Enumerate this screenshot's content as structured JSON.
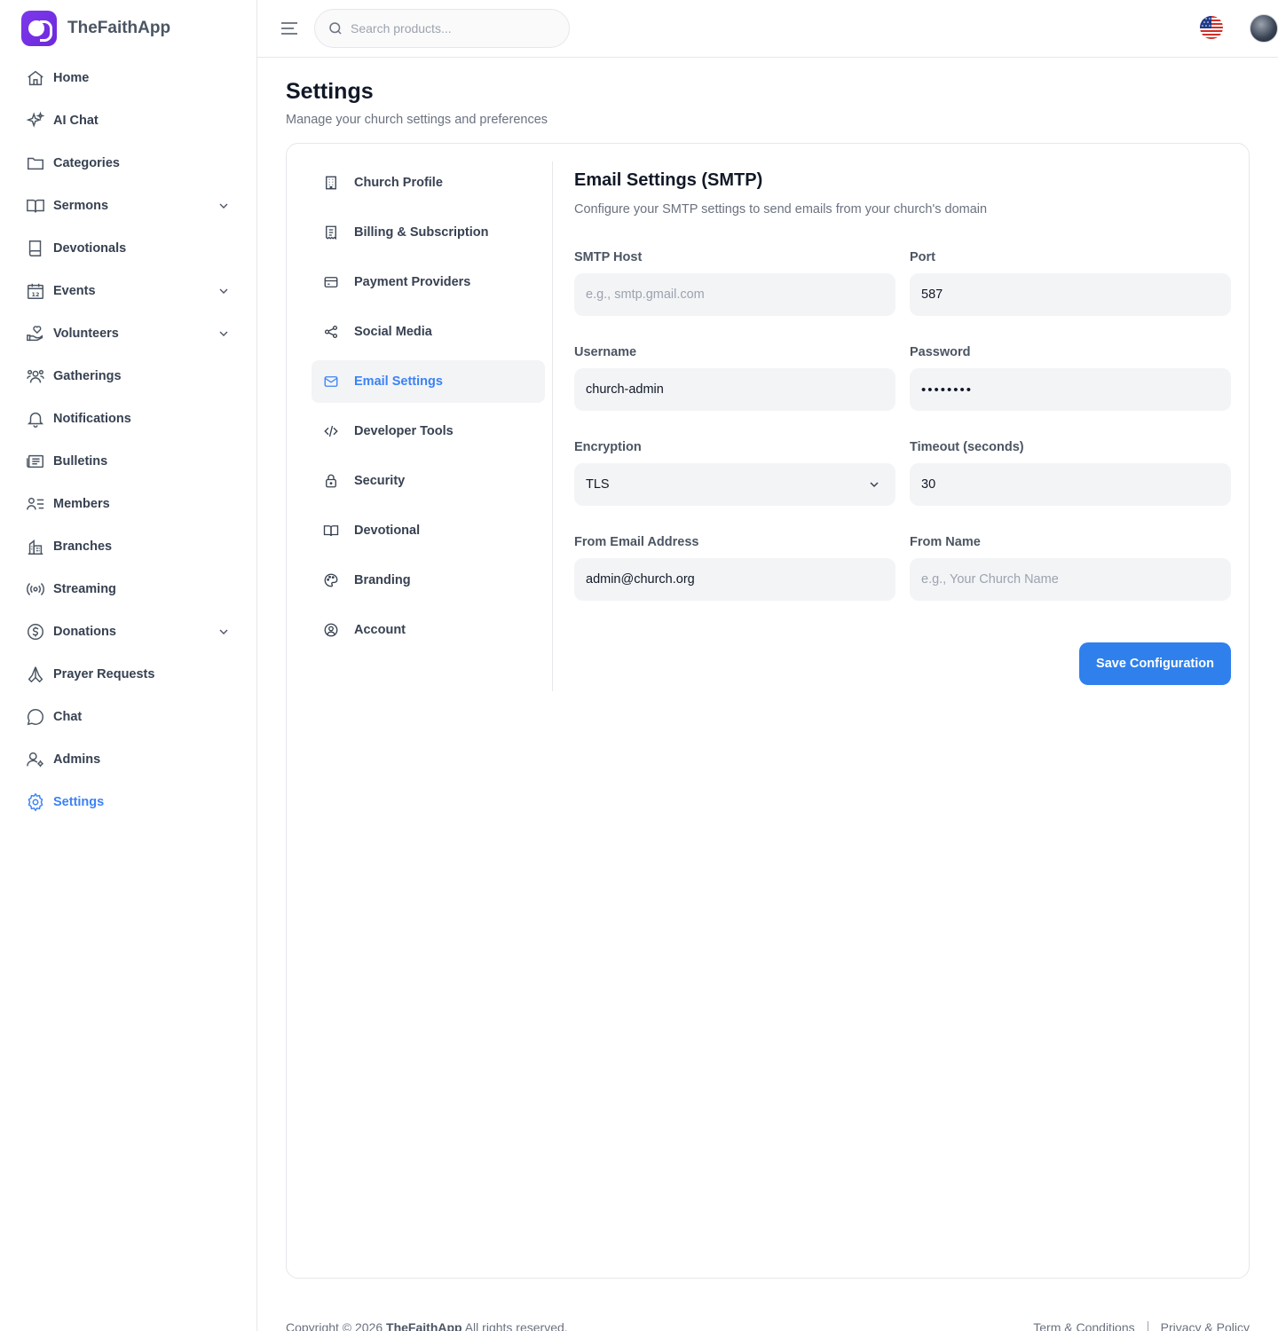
{
  "app": {
    "name": "TheFaithApp"
  },
  "sidebar": {
    "items": [
      {
        "label": "Home",
        "icon": "home-icon"
      },
      {
        "label": "AI Chat",
        "icon": "sparkles-icon"
      },
      {
        "label": "Categories",
        "icon": "folder-icon"
      },
      {
        "label": "Sermons",
        "icon": "book-open-icon",
        "expandable": true
      },
      {
        "label": "Devotionals",
        "icon": "book-icon"
      },
      {
        "label": "Events",
        "icon": "calendar-icon",
        "expandable": true
      },
      {
        "label": "Volunteers",
        "icon": "hand-heart-icon",
        "expandable": true
      },
      {
        "label": "Gatherings",
        "icon": "users-icon"
      },
      {
        "label": "Notifications",
        "icon": "bell-icon"
      },
      {
        "label": "Bulletins",
        "icon": "newspaper-icon"
      },
      {
        "label": "Members",
        "icon": "user-list-icon"
      },
      {
        "label": "Branches",
        "icon": "building-icon"
      },
      {
        "label": "Streaming",
        "icon": "broadcast-icon"
      },
      {
        "label": "Donations",
        "icon": "dollar-icon",
        "expandable": true
      },
      {
        "label": "Prayer Requests",
        "icon": "praying-hands-icon"
      },
      {
        "label": "Chat",
        "icon": "chat-bubble-icon"
      },
      {
        "label": "Admins",
        "icon": "user-gear-icon"
      },
      {
        "label": "Settings",
        "icon": "gear-icon",
        "active": true
      }
    ]
  },
  "header": {
    "search_placeholder": "Search products...",
    "language_flag": "us-flag-icon"
  },
  "page": {
    "title": "Settings",
    "subtitle": "Manage your church settings and preferences"
  },
  "settings_nav": {
    "items": [
      {
        "label": "Church Profile",
        "icon": "building-icon"
      },
      {
        "label": "Billing & Subscription",
        "icon": "receipt-icon"
      },
      {
        "label": "Payment Providers",
        "icon": "credit-card-icon"
      },
      {
        "label": "Social Media",
        "icon": "share-icon"
      },
      {
        "label": "Email Settings",
        "icon": "mail-icon",
        "active": true
      },
      {
        "label": "Developer Tools",
        "icon": "code-icon"
      },
      {
        "label": "Security",
        "icon": "lock-icon"
      },
      {
        "label": "Devotional",
        "icon": "book-open-icon"
      },
      {
        "label": "Branding",
        "icon": "palette-icon"
      },
      {
        "label": "Account",
        "icon": "user-circle-icon"
      }
    ]
  },
  "form": {
    "title": "Email Settings (SMTP)",
    "description": "Configure your SMTP settings to send emails from your church's domain",
    "fields": {
      "smtp_host": {
        "label": "SMTP Host",
        "value": "",
        "placeholder": "e.g., smtp.gmail.com"
      },
      "port": {
        "label": "Port",
        "value": "587"
      },
      "username": {
        "label": "Username",
        "value": "church-admin"
      },
      "password": {
        "label": "Password",
        "value": "••••••••"
      },
      "encryption": {
        "label": "Encryption",
        "value": "TLS"
      },
      "timeout": {
        "label": "Timeout (seconds)",
        "value": "30"
      },
      "from_email": {
        "label": "From Email Address",
        "value": "admin@church.org"
      },
      "from_name": {
        "label": "From Name",
        "value": "",
        "placeholder": "e.g., Your Church Name"
      }
    },
    "save_label": "Save Configuration"
  },
  "footer": {
    "copyright_prefix": "Copyright © 2026",
    "brand": "TheFaithApp",
    "copyright_suffix": "All rights reserved.",
    "terms": "Term & Conditions",
    "privacy": "Privacy & Policy"
  },
  "colors": {
    "accent": "#3b82f6",
    "primary_button": "#2f80ed",
    "brand": "#7c3aed"
  }
}
